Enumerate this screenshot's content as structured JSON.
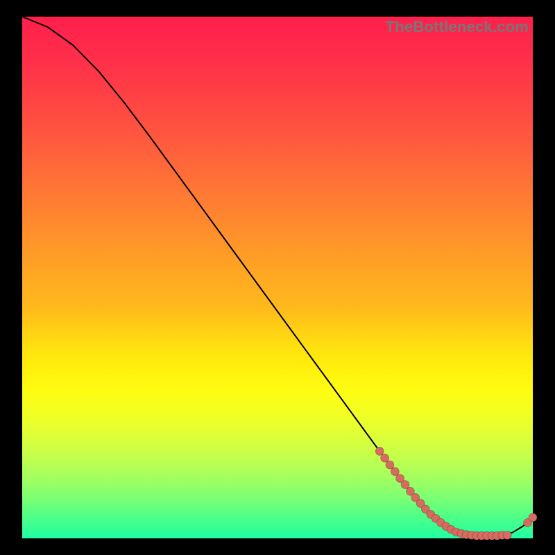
{
  "watermark": "TheBottleneck.com",
  "chart_data": {
    "type": "line",
    "title": "",
    "xlabel": "",
    "ylabel": "",
    "xlim": [
      0,
      100
    ],
    "ylim": [
      0,
      100
    ],
    "x": [
      0,
      5,
      10,
      15,
      20,
      25,
      30,
      35,
      40,
      45,
      50,
      55,
      60,
      65,
      70,
      72,
      74,
      76,
      78,
      80,
      82,
      84,
      86,
      88,
      90,
      92,
      94,
      96,
      98,
      100
    ],
    "values": [
      100,
      98,
      94.5,
      89.5,
      83.5,
      77,
      70.3,
      63.6,
      56.9,
      50.2,
      43.5,
      36.8,
      30.1,
      23.4,
      16.7,
      14.1,
      11.5,
      9.0,
      6.7,
      4.6,
      3.0,
      1.8,
      1.0,
      0.6,
      0.5,
      0.5,
      0.6,
      1.1,
      2.3,
      4.0
    ],
    "scatter_points": [
      {
        "x": 70,
        "y": 16.7
      },
      {
        "x": 71,
        "y": 15.4
      },
      {
        "x": 72,
        "y": 14.1
      },
      {
        "x": 73,
        "y": 12.8
      },
      {
        "x": 74,
        "y": 11.5
      },
      {
        "x": 75,
        "y": 10.3
      },
      {
        "x": 76,
        "y": 9.0
      },
      {
        "x": 77,
        "y": 7.8
      },
      {
        "x": 78,
        "y": 6.7
      },
      {
        "x": 79,
        "y": 5.6
      },
      {
        "x": 80,
        "y": 4.6
      },
      {
        "x": 81,
        "y": 3.8
      },
      {
        "x": 82,
        "y": 3.0
      },
      {
        "x": 83,
        "y": 2.3
      },
      {
        "x": 84,
        "y": 1.7
      },
      {
        "x": 85,
        "y": 1.2
      },
      {
        "x": 86,
        "y": 0.9
      },
      {
        "x": 87,
        "y": 0.7
      },
      {
        "x": 88,
        "y": 0.6
      },
      {
        "x": 89,
        "y": 0.5
      },
      {
        "x": 90,
        "y": 0.5
      },
      {
        "x": 91,
        "y": 0.5
      },
      {
        "x": 92,
        "y": 0.5
      },
      {
        "x": 93,
        "y": 0.5
      },
      {
        "x": 94,
        "y": 0.6
      },
      {
        "x": 95,
        "y": 0.6
      },
      {
        "x": 99,
        "y": 3.0
      },
      {
        "x": 100,
        "y": 4.0
      }
    ]
  }
}
